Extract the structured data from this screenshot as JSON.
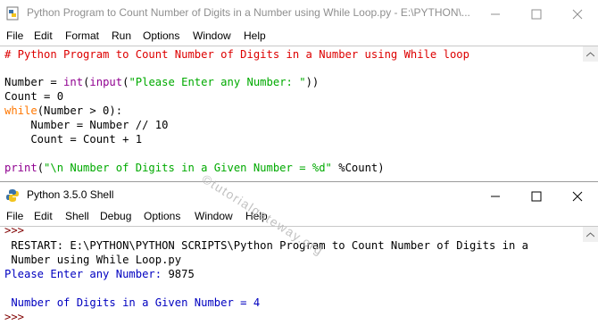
{
  "editor": {
    "title": "Python Program to Count Number of Digits in a Number using While Loop.py - E:\\PYTHON\\...",
    "menu": [
      "File",
      "Edit",
      "Format",
      "Run",
      "Options",
      "Window",
      "Help"
    ],
    "code": {
      "comment": "# Python Program to Count Number of Digits in a Number using While loop",
      "l1a": "Number = ",
      "l1b": "int",
      "l1c": "(",
      "l1d": "input",
      "l1e": "(",
      "l1f": "\"Please Enter any Number: \"",
      "l1g": "))",
      "l2": "Count = 0",
      "l3a": "while",
      "l3b": "(Number > 0):",
      "l4": "    Number = Number // 10",
      "l5": "    Count = Count + 1",
      "l6a": "print",
      "l6b": "(",
      "l6c": "\"\\n Number of Digits in a Given Number = %d\"",
      "l6d": " %Count)"
    }
  },
  "shell": {
    "title": "Python 3.5.0 Shell",
    "menu": [
      "File",
      "Edit",
      "Shell",
      "Debug",
      "Options",
      "Window",
      "Help"
    ],
    "lines": {
      "p1": ">>>",
      "restart1": " RESTART: E:\\PYTHON\\PYTHON SCRIPTS\\Python Program to Count Number of Digits in a",
      "restart2": " Number using While Loop.py",
      "ask": "Please Enter any Number: ",
      "input": "9875",
      "result": " Number of Digits in a Given Number = 4",
      "p2": ">>>"
    }
  },
  "watermark": "©tutorialgateway.org"
}
